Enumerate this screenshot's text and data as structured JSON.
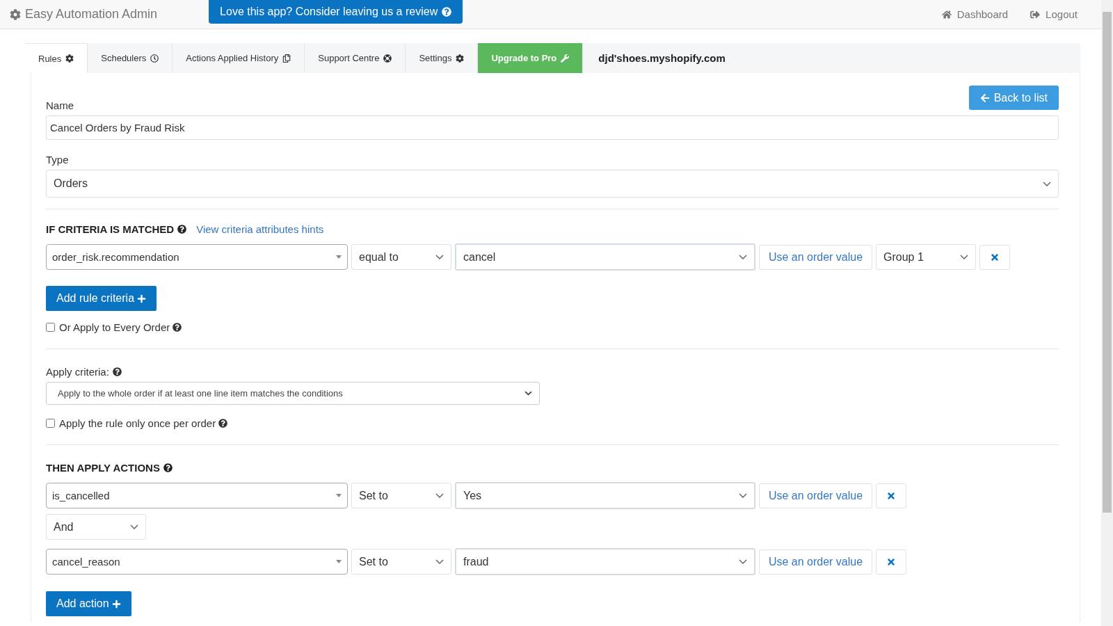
{
  "header": {
    "app_title": "Easy Automation Admin",
    "review_button": "Love this app? Consider leaving us a review",
    "nav": [
      {
        "label": "Dashboard",
        "kind": "home"
      },
      {
        "label": "Logout",
        "kind": "logout"
      }
    ]
  },
  "tabs": [
    {
      "label": "Rules",
      "selected": true,
      "kind": "normal"
    },
    {
      "label": "Schedulers",
      "selected": false,
      "kind": "normal"
    },
    {
      "label": "Actions Applied History",
      "selected": false,
      "kind": "normal"
    },
    {
      "label": "Support Centre",
      "selected": false,
      "kind": "normal"
    },
    {
      "label": "Settings",
      "selected": false,
      "kind": "normal"
    },
    {
      "label": "Upgrade to Pro",
      "selected": false,
      "kind": "promo"
    }
  ],
  "store": "djd'shoes.myshopify.com",
  "form": {
    "back_button": "Back to list",
    "name": {
      "label": "Name",
      "value": "Cancel Orders by Fraud Risk"
    },
    "type": {
      "label": "Type",
      "value": "Orders"
    },
    "criteria": {
      "heading": "IF CRITERIA IS MATCHED",
      "hints_link": "View criteria attributes hints",
      "rows": [
        {
          "field": "order_risk.recommendation",
          "operator": "equal to",
          "value": "cancel",
          "use_value_button": "Use an order value",
          "group": "Group 1"
        }
      ],
      "add_button": "Add rule criteria",
      "every_order": {
        "label": "Or Apply to Every Order",
        "checked": false
      }
    },
    "apply_criteria": {
      "label": "Apply criteria:",
      "value": "Apply to the whole order if at least one line item matches the conditions"
    },
    "once_per_order": {
      "label": "Apply the rule only once per order",
      "checked": false
    },
    "actions": {
      "heading": "THEN APPLY ACTIONS",
      "rows": [
        {
          "kind": "action",
          "field": "is_cancelled",
          "operator": "Set to",
          "value": "Yes",
          "use_value_button": "Use an order value"
        },
        {
          "kind": "connector",
          "value": "And"
        },
        {
          "kind": "action",
          "field": "cancel_reason",
          "operator": "Set to",
          "value": "fraud",
          "use_value_button": "Use an order value"
        }
      ],
      "add_button": "Add action"
    }
  }
}
